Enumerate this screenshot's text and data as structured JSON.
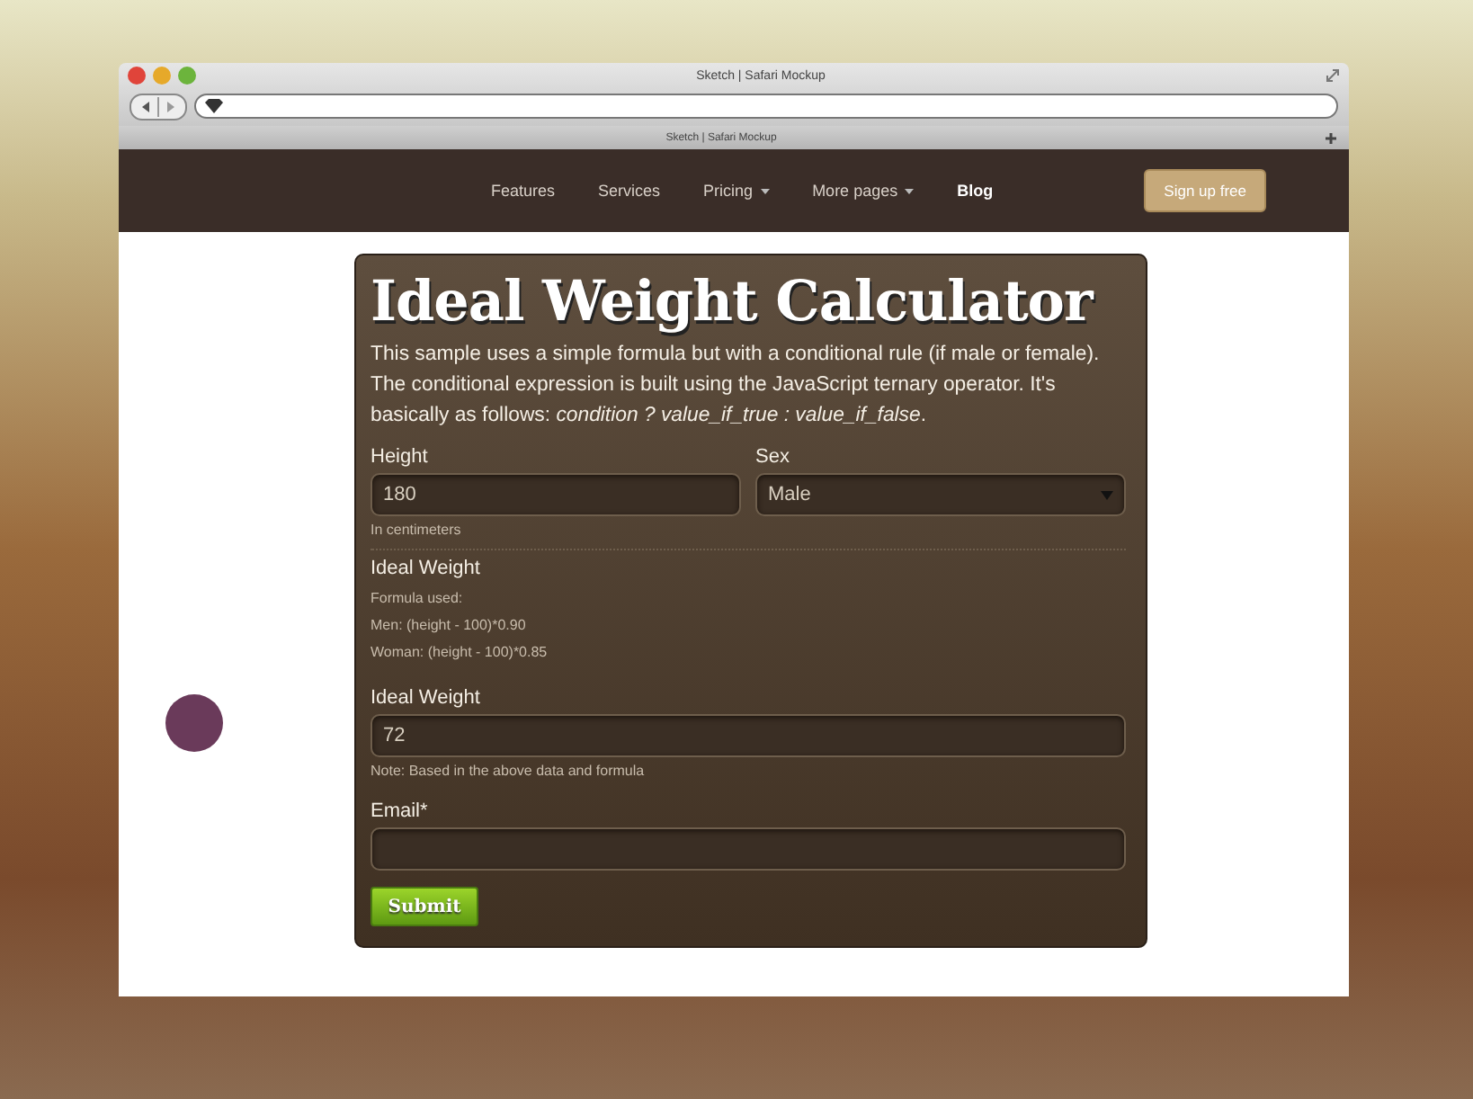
{
  "window": {
    "title": "Sketch | Safari Mockup",
    "tab_title": "Sketch | Safari Mockup"
  },
  "nav": {
    "items": [
      {
        "label": "Features",
        "kind": "link",
        "selected": false
      },
      {
        "label": "Services",
        "kind": "link",
        "selected": false
      },
      {
        "label": "Pricing",
        "kind": "dropdown",
        "selected": false
      },
      {
        "label": "More pages",
        "kind": "dropdown",
        "selected": false
      },
      {
        "label": "Blog",
        "kind": "link",
        "selected": true
      }
    ],
    "cta": "Sign up free"
  },
  "form": {
    "title": "Ideal Weight Calculator",
    "description": "This sample uses a simple formula but with a conditional rule (if male or female). The conditional expression is built using the JavaScript ternary operator. It's basically as follows: *condition ? value_if_true : value_if_false*.",
    "height": {
      "label": "Height",
      "value": "180",
      "help": "In centimeters"
    },
    "sex": {
      "label": "Sex",
      "value": "Male"
    },
    "formula": {
      "label": "Ideal Weight",
      "lines": [
        "Formula used:",
        "Men: (height - 100)*0.90",
        "Woman: (height - 100)*0.85"
      ]
    },
    "result": {
      "label": "Ideal Weight",
      "value": "72",
      "help": "Note: Based in the above data and formula"
    },
    "email": {
      "label": "Email*"
    },
    "submit": "Submit"
  }
}
